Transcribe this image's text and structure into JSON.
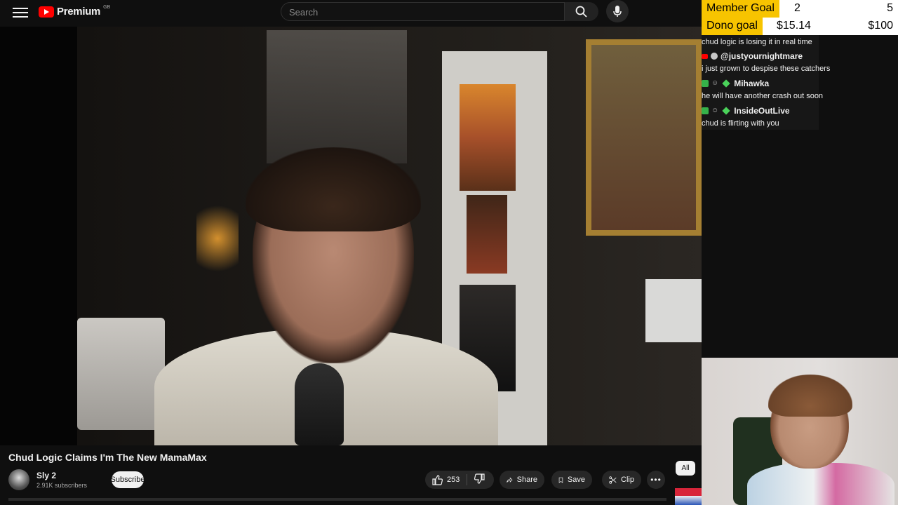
{
  "header": {
    "logo_text": "Premium",
    "logo_region": "GB",
    "search_placeholder": "Search"
  },
  "overlay": {
    "goals": [
      {
        "label": "Member Goal",
        "current": "2",
        "target": "5"
      },
      {
        "label": "Dono goal",
        "current": "$15.14",
        "target": "$100"
      }
    ],
    "chat": {
      "first_message": "chud logic is losing it in real time",
      "messages": [
        {
          "user": "@justyournightmare",
          "text": "i just grown to despise these catchers"
        },
        {
          "user": "Mihawka",
          "text": "he will have another crash out soon"
        },
        {
          "user": "InsideOutLive",
          "text": "chud is flirting with you"
        }
      ]
    }
  },
  "video": {
    "title": "Chud Logic Claims I'm The New MamaMax",
    "channel_name": "Sly 2",
    "subscribers": "2.91K subscribers",
    "subscribe_label": "Subscribe",
    "like_count": "253",
    "share_label": "Share",
    "save_label": "Save",
    "clip_label": "Clip"
  },
  "side": {
    "chip_all": "All"
  },
  "icons": {
    "menu": "menu-icon",
    "search": "search-icon",
    "mic": "mic-icon",
    "like": "thumbs-up-icon",
    "dislike": "thumbs-down-icon",
    "share": "share-icon",
    "save": "bookmark-icon",
    "clip": "scissors-icon",
    "more": "more-icon"
  },
  "colors": {
    "accent": "#ff0000",
    "goal_label_bg": "#f7c400",
    "chat_badge_green": "#36b24a"
  }
}
